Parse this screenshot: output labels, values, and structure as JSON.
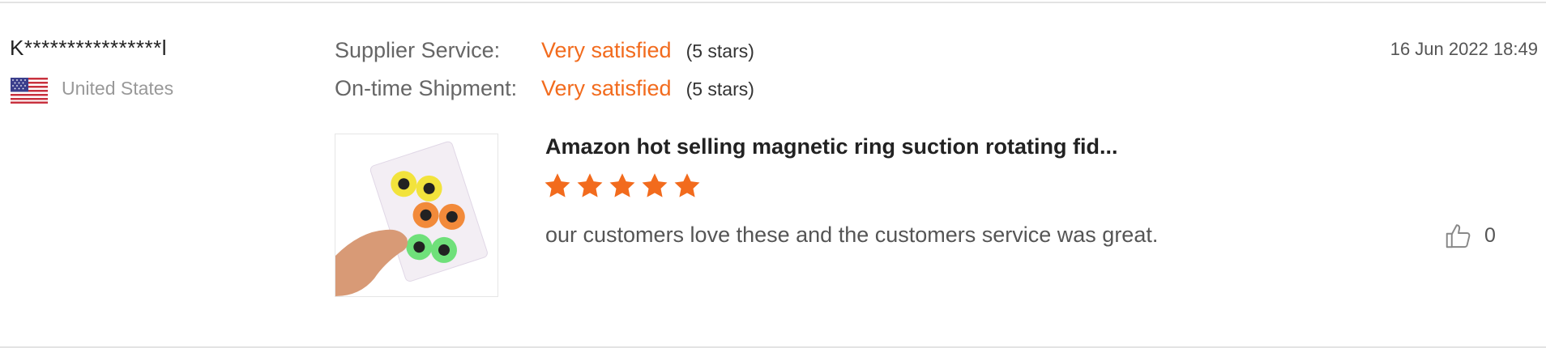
{
  "review": {
    "reviewer_name": "K****************l",
    "country": "United States",
    "date": "16 Jun 2022 18:49",
    "ratings": [
      {
        "label": "Supplier Service:",
        "value": "Very satisfied",
        "stars_text": "(5 stars)"
      },
      {
        "label": "On-time Shipment:",
        "value": "Very satisfied",
        "stars_text": "(5 stars)"
      }
    ],
    "product_title": "Amazon hot selling magnetic ring suction rotating fid...",
    "star_rating": 5,
    "comment": "our customers love these and the customers service was great.",
    "likes": "0"
  },
  "colors": {
    "accent": "#f26b1d",
    "star": "#f26b1d",
    "divider": "#e3e3e3"
  },
  "icons": {
    "flag": "us-flag-icon",
    "like": "thumbs-up-icon",
    "star": "star-icon"
  }
}
